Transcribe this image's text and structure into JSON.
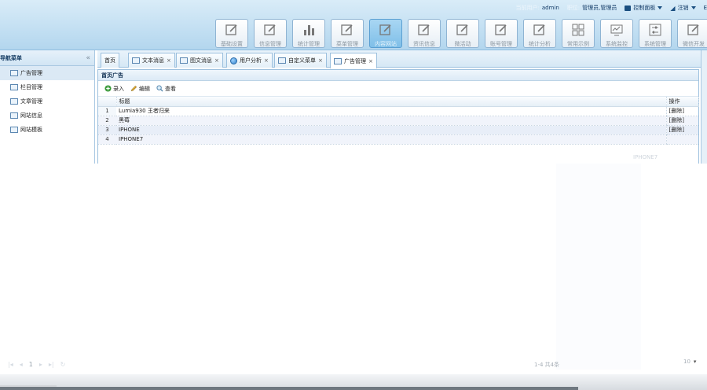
{
  "header": {
    "current_user_label": "当前用户:",
    "current_user": "admin",
    "role_label": "职位:",
    "role": "管理员,管理员",
    "control_panel": "控制面板",
    "logout": "注销"
  },
  "tiles": [
    {
      "label": "基础设置",
      "icon": "edit-icon"
    },
    {
      "label": "信息管理",
      "icon": "edit-icon"
    },
    {
      "label": "统计管理",
      "icon": "bar-chart-icon"
    },
    {
      "label": "菜单管理",
      "icon": "edit-icon"
    },
    {
      "label": "内容网站",
      "icon": "edit-icon",
      "active": true
    },
    {
      "label": "资讯信息",
      "icon": "edit-icon"
    },
    {
      "label": "微活动",
      "icon": "edit-icon"
    },
    {
      "label": "账号管理",
      "icon": "edit-icon"
    },
    {
      "label": "统计分析",
      "icon": "edit-icon"
    },
    {
      "label": "常用示例",
      "icon": "grid-icon"
    },
    {
      "label": "系统监控",
      "icon": "monitor-icon"
    },
    {
      "label": "系统管理",
      "icon": "sliders-icon"
    },
    {
      "label": "微信开发",
      "icon": "edit-icon"
    }
  ],
  "nav": {
    "title": "导航菜单",
    "collapse": "«",
    "items": [
      {
        "label": "广告管理",
        "selected": true
      },
      {
        "label": "栏目管理"
      },
      {
        "label": "文章管理"
      },
      {
        "label": "网站信息"
      },
      {
        "label": "网站模板"
      }
    ]
  },
  "tabs": [
    {
      "label": "首页",
      "closable": false
    },
    {
      "label": "文本消息",
      "closable": true
    },
    {
      "label": "图文消息",
      "closable": true
    },
    {
      "label": "用户分析",
      "closable": true,
      "icon": "globe"
    },
    {
      "label": "自定义菜单",
      "closable": true
    },
    {
      "label": "广告管理",
      "closable": true,
      "active": true
    }
  ],
  "panel": {
    "title": "首页广告",
    "toolbar": [
      {
        "label": "录入",
        "icon": "add-icon"
      },
      {
        "label": "编辑",
        "icon": "pencil-icon"
      },
      {
        "label": "查看",
        "icon": "magnifier-icon"
      }
    ],
    "columns": {
      "title": "标题",
      "action": "操作"
    },
    "rows": [
      {
        "num": "1",
        "title": "Lumia930 王者归来",
        "action": "[删除]"
      },
      {
        "num": "2",
        "title": "黑莓",
        "action": "[删除]"
      },
      {
        "num": "3",
        "title": "IPHONE",
        "action": "[删除]"
      },
      {
        "num": "4",
        "title": "IPHONE7",
        "action": ""
      }
    ]
  },
  "faint": "IPHONE7",
  "pager": {
    "page": "1",
    "info": "1-4 共4条",
    "size": "10"
  }
}
